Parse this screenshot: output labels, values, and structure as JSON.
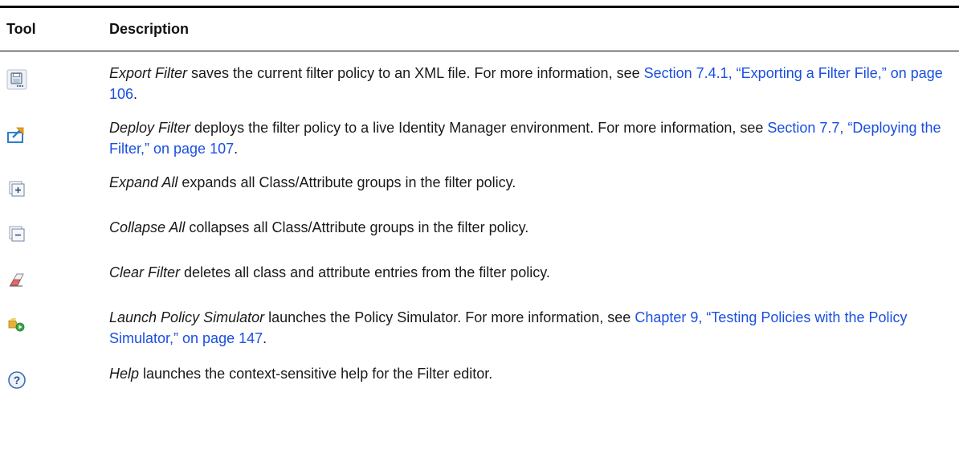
{
  "header": {
    "tool": "Tool",
    "description": "Description"
  },
  "rows": [
    {
      "icon": "export-filter-icon",
      "name": "Export Filter",
      "text": " saves the current filter policy to an XML file. For more information, see ",
      "link": "Section 7.4.1, “Exporting a Filter File,” on page 106",
      "after": "."
    },
    {
      "icon": "deploy-filter-icon",
      "name": "Deploy Filter",
      "text": " deploys the filter policy to a live Identity Manager environment. For more information, see ",
      "link": "Section 7.7, “Deploying the Filter,” on page 107",
      "after": "."
    },
    {
      "icon": "expand-all-icon",
      "name": "Expand All",
      "text": " expands all Class/Attribute groups in the filter policy."
    },
    {
      "icon": "collapse-all-icon",
      "name": "Collapse All",
      "text": " collapses all Class/Attribute groups in the filter policy."
    },
    {
      "icon": "clear-filter-icon",
      "name": "Clear Filter",
      "text": " deletes all class and attribute entries from the filter policy."
    },
    {
      "icon": "launch-policy-simulator-icon",
      "name": "Launch Policy Simulator",
      "text": " launches the Policy Simulator. For more information, see ",
      "link": "Chapter 9, “Testing Policies with the Policy Simulator,” on page 147",
      "after": "."
    },
    {
      "icon": "help-icon",
      "name": "Help",
      "text": " launches the context-sensitive help for the Filter editor."
    }
  ]
}
